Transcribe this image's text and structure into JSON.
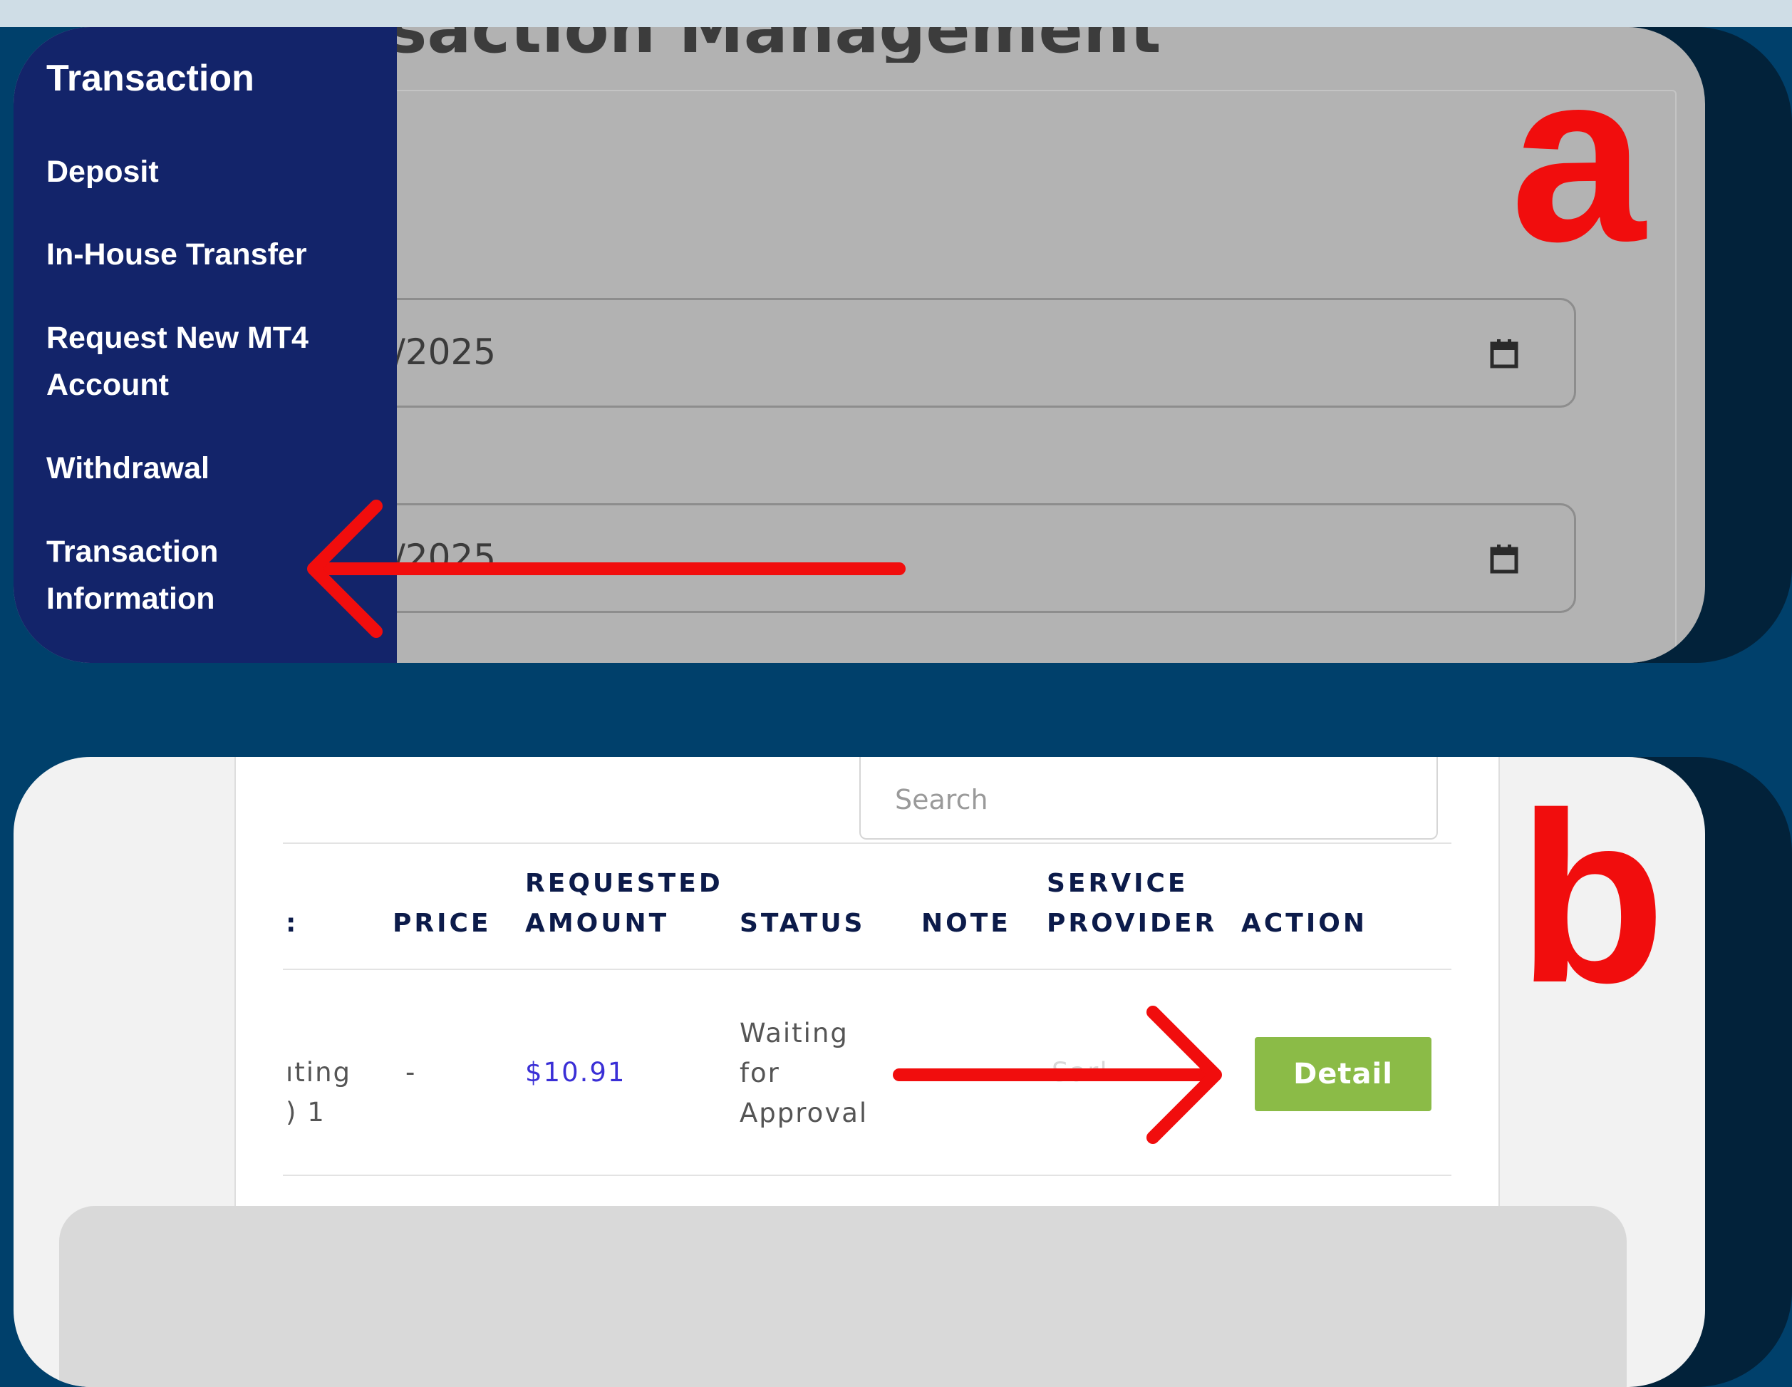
{
  "panel_a": {
    "marker": "a",
    "sidebar": {
      "title": "Transaction",
      "items": [
        {
          "label": "Deposit"
        },
        {
          "label": "In-House Transfer"
        },
        {
          "label": "Request New MT4 Account"
        },
        {
          "label": "Withdrawal"
        },
        {
          "label": "Transaction Information"
        }
      ]
    },
    "page_title": "Transaction Management",
    "date_from": {
      "value": "/2025",
      "icon": "calendar-icon"
    },
    "date_to": {
      "value": "/2025",
      "icon": "calendar-icon"
    }
  },
  "panel_b": {
    "marker": "b",
    "search": {
      "placeholder": "Search"
    },
    "table": {
      "headers": {
        "type_partial": ":",
        "price": "PRICE",
        "requested_amount": "REQUESTED AMOUNT",
        "status": "STATUS",
        "note": "NOTE",
        "service_provider": "SERVICE PROVIDER",
        "action": "ACTION"
      },
      "rows": [
        {
          "type_partial": "ıting ) 1",
          "price": "-",
          "requested_amount": "$10.91",
          "status": "Waiting for Approval",
          "note": "",
          "service_provider": "Sarl",
          "action_label": "Detail"
        }
      ]
    }
  },
  "colors": {
    "sidebar_bg": "#13246a",
    "accent_red": "#f10d0d",
    "detail_button": "#8bbb47",
    "table_header": "#0c1b4a",
    "amount_link": "#3a2fd6"
  }
}
